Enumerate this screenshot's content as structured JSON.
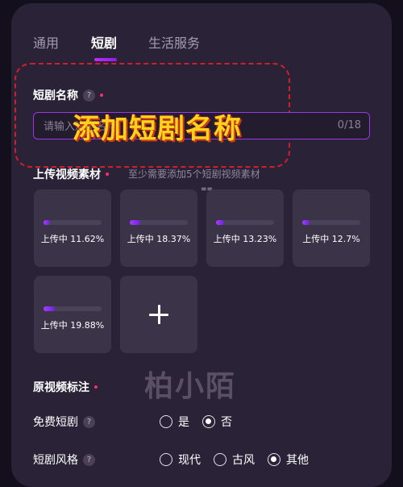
{
  "tabs": [
    {
      "label": "通用",
      "active": false
    },
    {
      "label": "短剧",
      "active": true
    },
    {
      "label": "生活服务",
      "active": false
    }
  ],
  "drama_name": {
    "label": "短剧名称",
    "help": "?",
    "placeholder": "请输入短剧名称",
    "value": "",
    "counter": "0/18"
  },
  "overlay_caption": "添加短剧名称",
  "upload": {
    "label": "上传视频素材",
    "hint": "至少需要添加5个短剧视频素材",
    "items": [
      {
        "status": "上传中 11.62%",
        "progress": 0.1162
      },
      {
        "status": "上传中 18.37%",
        "progress": 0.1837
      },
      {
        "status": "上传中 13.23%",
        "progress": 0.1323
      },
      {
        "status": "上传中 12.7%",
        "progress": 0.127
      },
      {
        "status": "上传中 19.88%",
        "progress": 0.1988
      }
    ]
  },
  "small_mark": "==",
  "watermark": "柏小陌",
  "original_note": {
    "label": "原视频标注"
  },
  "free_drama": {
    "label": "免费短剧",
    "help": "?",
    "options": [
      {
        "label": "是",
        "checked": false
      },
      {
        "label": "否",
        "checked": true
      }
    ]
  },
  "drama_style": {
    "label": "短剧风格",
    "help": "?",
    "options": [
      {
        "label": "现代",
        "checked": false
      },
      {
        "label": "古风",
        "checked": false
      },
      {
        "label": "其他",
        "checked": true
      }
    ]
  },
  "colors": {
    "accent": "#9b37e8",
    "required": "#ff2d6d",
    "caption": "#ffd21e",
    "annotation": "#d11e2c"
  }
}
